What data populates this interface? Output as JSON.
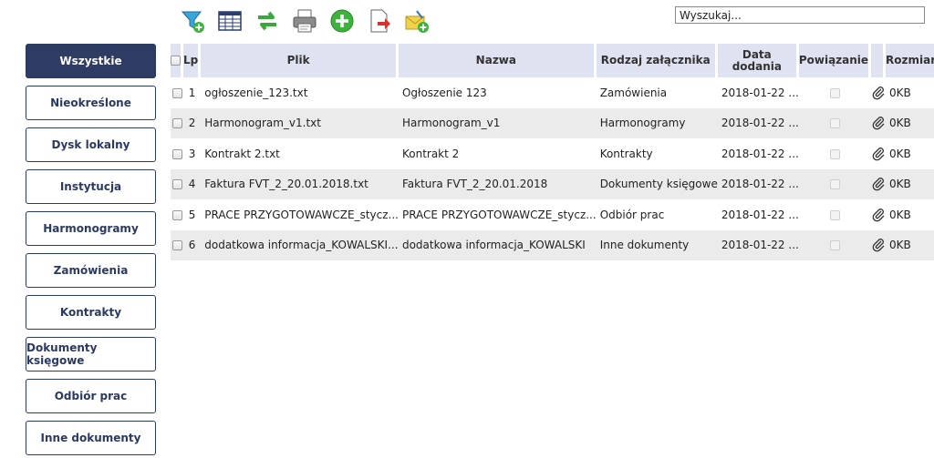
{
  "toolbar": {
    "buttons": [
      {
        "name": "filter-add-icon"
      },
      {
        "name": "table-columns-icon"
      },
      {
        "name": "refresh-icon"
      },
      {
        "name": "print-icon"
      },
      {
        "name": "add-icon"
      },
      {
        "name": "export-document-icon"
      },
      {
        "name": "attach-mail-icon"
      }
    ]
  },
  "search": {
    "placeholder": "Wyszukaj..."
  },
  "sidebar": {
    "items": [
      {
        "label": "Wszystkie",
        "active": true
      },
      {
        "label": "Nieokreślone"
      },
      {
        "label": "Dysk lokalny"
      },
      {
        "label": "Instytucja"
      },
      {
        "label": "Harmonogramy"
      },
      {
        "label": "Zamówienia"
      },
      {
        "label": "Kontrakty"
      },
      {
        "label": "Dokumenty księgowe"
      },
      {
        "label": "Odbiór prac"
      },
      {
        "label": "Inne dokumenty"
      }
    ]
  },
  "table": {
    "headers": {
      "lp": "Lp",
      "plik": "Plik",
      "nazwa": "Nazwa",
      "rodzaj": "Rodzaj załącznika",
      "data_line1": "Data",
      "data_line2": "dodania",
      "powiazanie": "Powiązanie",
      "rozmiar": "Rozmiar"
    },
    "rows": [
      {
        "lp": "1",
        "plik": "ogłoszenie_123.txt",
        "nazwa": "Ogłoszenie 123",
        "rodzaj": "Zamówienia",
        "data": "2018-01-22 ...",
        "rozmiar": "0KB"
      },
      {
        "lp": "2",
        "plik": "Harmonogram_v1.txt",
        "nazwa": "Harmonogram_v1",
        "rodzaj": "Harmonogramy",
        "data": "2018-01-22 ...",
        "rozmiar": "0KB"
      },
      {
        "lp": "3",
        "plik": "Kontrakt 2.txt",
        "nazwa": "Kontrakt 2",
        "rodzaj": "Kontrakty",
        "data": "2018-01-22 ...",
        "rozmiar": "0KB"
      },
      {
        "lp": "4",
        "plik": "Faktura FVT_2_20.01.2018.txt",
        "nazwa": "Faktura FVT_2_20.01.2018",
        "rodzaj": "Dokumenty księgowe",
        "data": "2018-01-22 ...",
        "rozmiar": "0KB"
      },
      {
        "lp": "5",
        "plik": "PRACE PRZYGOTOWAWCZE_stycz...",
        "nazwa": "PRACE PRZYGOTOWAWCZE_stycz...",
        "rodzaj": "Odbiór prac",
        "data": "2018-01-22 ...",
        "rozmiar": "0KB"
      },
      {
        "lp": "6",
        "plik": "dodatkowa informacja_KOWALSKI...",
        "nazwa": "dodatkowa informacja_KOWALSKI",
        "rodzaj": "Inne dokumenty",
        "data": "2018-01-22 ...",
        "rozmiar": "0KB"
      }
    ]
  },
  "colors": {
    "accent": "#2e3b63",
    "header_bg": "#dfe2f0",
    "row_alt": "#ebebeb"
  }
}
